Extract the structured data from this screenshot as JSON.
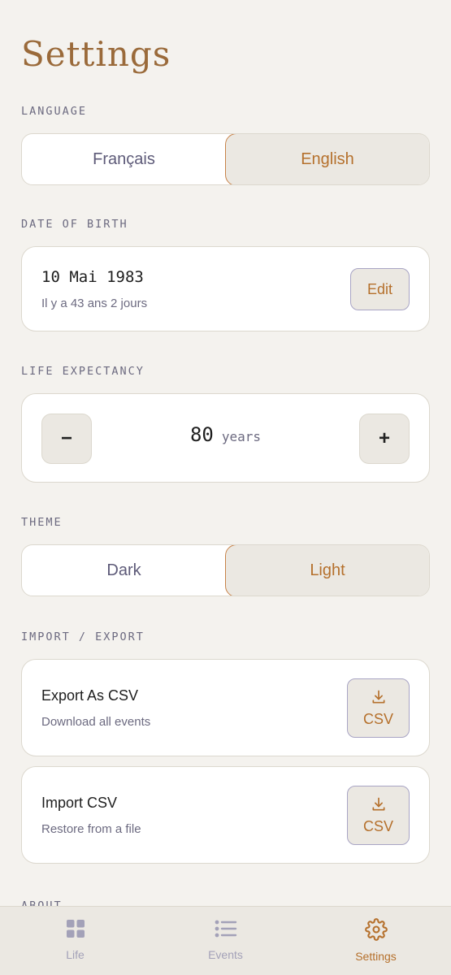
{
  "page": {
    "title": "Settings"
  },
  "language": {
    "label": "LANGUAGE",
    "options": [
      "Français",
      "English"
    ],
    "selected": "English"
  },
  "dob": {
    "label": "DATE OF BIRTH",
    "value": "10 Mai 1983",
    "relative": "Il y a 43 ans 2 jours",
    "edit_label": "Edit"
  },
  "life_expectancy": {
    "label": "LIFE EXPECTANCY",
    "value": "80",
    "unit": "years",
    "minus": "−",
    "plus": "+"
  },
  "theme": {
    "label": "THEME",
    "options": [
      "Dark",
      "Light"
    ],
    "selected": "Light"
  },
  "import_export": {
    "label": "IMPORT / EXPORT",
    "export": {
      "title": "Export As CSV",
      "subtitle": "Download all events",
      "button": "CSV",
      "icon": "download-icon"
    },
    "import": {
      "title": "Import CSV",
      "subtitle": "Restore from a file",
      "button": "CSV",
      "icon": "download-icon"
    }
  },
  "about": {
    "label": "ABOUT"
  },
  "tabbar": {
    "items": [
      {
        "label": "Life",
        "icon": "grid-icon"
      },
      {
        "label": "Events",
        "icon": "list-icon"
      },
      {
        "label": "Settings",
        "icon": "gear-icon"
      }
    ],
    "active": "Settings"
  },
  "colors": {
    "accent": "#b5702c",
    "background": "#f4f2ee",
    "muted": "#6c6a80"
  }
}
